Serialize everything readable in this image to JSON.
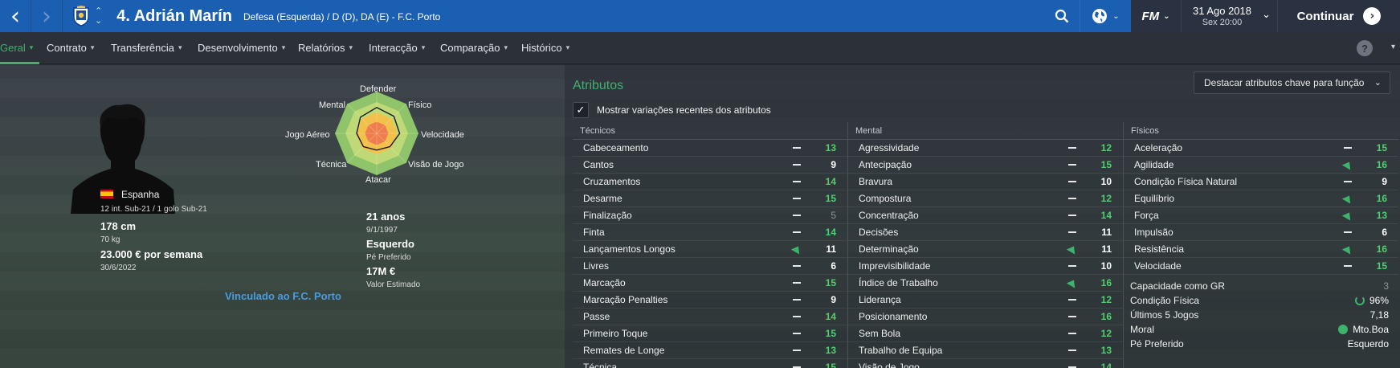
{
  "topbar": {
    "player_title": "4. Adrián Marín",
    "player_sub": "Defesa (Esquerda) / D (D), DA (E) - F.C. Porto",
    "date_main": "31 Ago 2018",
    "date_sub": "Sex 20:00",
    "continue_label": "Continuar",
    "fm_label": "FM"
  },
  "tabs": [
    {
      "label": "Geral",
      "active": true
    },
    {
      "label": "Contrato"
    },
    {
      "label": "Transferência"
    },
    {
      "label": "Desenvolvimento"
    },
    {
      "label": "Relatórios"
    },
    {
      "label": "Interacção"
    },
    {
      "label": "Comparação"
    },
    {
      "label": "Histórico"
    }
  ],
  "help_label": "?",
  "profile": {
    "nation": "Espanha",
    "intl": "12 int. Sub-21 / 1 golo Sub-21",
    "height": "178 cm",
    "weight": "70 kg",
    "wage": "23.000 € por semana",
    "contract_end": "30/6/2022",
    "age": "21 anos",
    "dob": "9/1/1997",
    "foot": "Esquerdo",
    "foot_label": "Pé Preferido",
    "value": "17M €",
    "value_label": "Valor Estimado",
    "linked": "Vinculado ao F.C. Porto"
  },
  "radar": {
    "labels": [
      "Defender",
      "Físico",
      "Velocidade",
      "Visão de Jogo",
      "Atacar",
      "Técnica",
      "Jogo Aéreo",
      "Mental"
    ],
    "values": [
      0.62,
      0.58,
      0.55,
      0.45,
      0.4,
      0.45,
      0.48,
      0.55
    ]
  },
  "attributes": {
    "title": "Atributos",
    "highlight_dropdown": "Destacar atributos chave para função",
    "show_changes": "Mostrar variações recentes dos atributos",
    "tecnicos": {
      "heading": "Técnicos",
      "rows": [
        {
          "name": "Cabeceamento",
          "trend": "none",
          "value": "13",
          "tone": "green"
        },
        {
          "name": "Cantos",
          "trend": "none",
          "value": "9",
          "tone": "white"
        },
        {
          "name": "Cruzamentos",
          "trend": "none",
          "value": "14",
          "tone": "green"
        },
        {
          "name": "Desarme",
          "trend": "none",
          "value": "15",
          "tone": "green"
        },
        {
          "name": "Finalização",
          "trend": "none",
          "value": "5",
          "tone": "grey"
        },
        {
          "name": "Finta",
          "trend": "none",
          "value": "14",
          "tone": "green"
        },
        {
          "name": "Lançamentos Longos",
          "trend": "up",
          "value": "11",
          "tone": "white"
        },
        {
          "name": "Livres",
          "trend": "none",
          "value": "6",
          "tone": "white"
        },
        {
          "name": "Marcação",
          "trend": "none",
          "value": "15",
          "tone": "green"
        },
        {
          "name": "Marcação Penalties",
          "trend": "none",
          "value": "9",
          "tone": "white"
        },
        {
          "name": "Passe",
          "trend": "none",
          "value": "14",
          "tone": "green"
        },
        {
          "name": "Primeiro Toque",
          "trend": "none",
          "value": "15",
          "tone": "green"
        },
        {
          "name": "Remates de Longe",
          "trend": "none",
          "value": "13",
          "tone": "green"
        },
        {
          "name": "Técnica",
          "trend": "none",
          "value": "15",
          "tone": "green"
        }
      ]
    },
    "mental": {
      "heading": "Mental",
      "rows": [
        {
          "name": "Agressividade",
          "trend": "none",
          "value": "12",
          "tone": "green"
        },
        {
          "name": "Antecipação",
          "trend": "none",
          "value": "15",
          "tone": "green"
        },
        {
          "name": "Bravura",
          "trend": "none",
          "value": "10",
          "tone": "white"
        },
        {
          "name": "Compostura",
          "trend": "none",
          "value": "12",
          "tone": "green"
        },
        {
          "name": "Concentração",
          "trend": "none",
          "value": "14",
          "tone": "green"
        },
        {
          "name": "Decisões",
          "trend": "none",
          "value": "11",
          "tone": "white"
        },
        {
          "name": "Determinação",
          "trend": "up",
          "value": "11",
          "tone": "white"
        },
        {
          "name": "Imprevisibilidade",
          "trend": "none",
          "value": "10",
          "tone": "white"
        },
        {
          "name": "Índice de Trabalho",
          "trend": "up",
          "value": "16",
          "tone": "green"
        },
        {
          "name": "Liderança",
          "trend": "none",
          "value": "12",
          "tone": "green"
        },
        {
          "name": "Posicionamento",
          "trend": "none",
          "value": "16",
          "tone": "green"
        },
        {
          "name": "Sem Bola",
          "trend": "none",
          "value": "12",
          "tone": "green"
        },
        {
          "name": "Trabalho de Equipa",
          "trend": "none",
          "value": "13",
          "tone": "green"
        },
        {
          "name": "Visão de Jogo",
          "trend": "none",
          "value": "14",
          "tone": "green"
        }
      ]
    },
    "fisicos": {
      "heading": "Físicos",
      "rows": [
        {
          "name": "Aceleração",
          "trend": "none",
          "value": "15",
          "tone": "green"
        },
        {
          "name": "Agilidade",
          "trend": "up",
          "value": "16",
          "tone": "green"
        },
        {
          "name": "Condição Física Natural",
          "trend": "none",
          "value": "9",
          "tone": "white"
        },
        {
          "name": "Equilíbrio",
          "trend": "up",
          "value": "16",
          "tone": "green"
        },
        {
          "name": "Força",
          "trend": "up",
          "value": "13",
          "tone": "green"
        },
        {
          "name": "Impulsão",
          "trend": "none",
          "value": "6",
          "tone": "white"
        },
        {
          "name": "Resistência",
          "trend": "up",
          "value": "16",
          "tone": "green"
        },
        {
          "name": "Velocidade",
          "trend": "none",
          "value": "15",
          "tone": "green"
        }
      ]
    },
    "summary": [
      {
        "name": "Capacidade como GR",
        "value": "3",
        "tone": "grey"
      },
      {
        "name": "Condição Física",
        "value": "96%",
        "tone": "white",
        "icon": "fitness-ring-icon"
      },
      {
        "name": "Últimos 5 Jogos",
        "value": "7,18",
        "tone": "white"
      },
      {
        "name": "Moral",
        "value": "Mto.Boa",
        "tone": "white",
        "icon": "morale-up-icon"
      },
      {
        "name": "Pé Preferido",
        "value": "Esquerdo",
        "tone": "white"
      }
    ]
  },
  "colors": {
    "accent": "#3db36c",
    "topbar": "#1b5fb3",
    "link": "#4a9ce0"
  }
}
